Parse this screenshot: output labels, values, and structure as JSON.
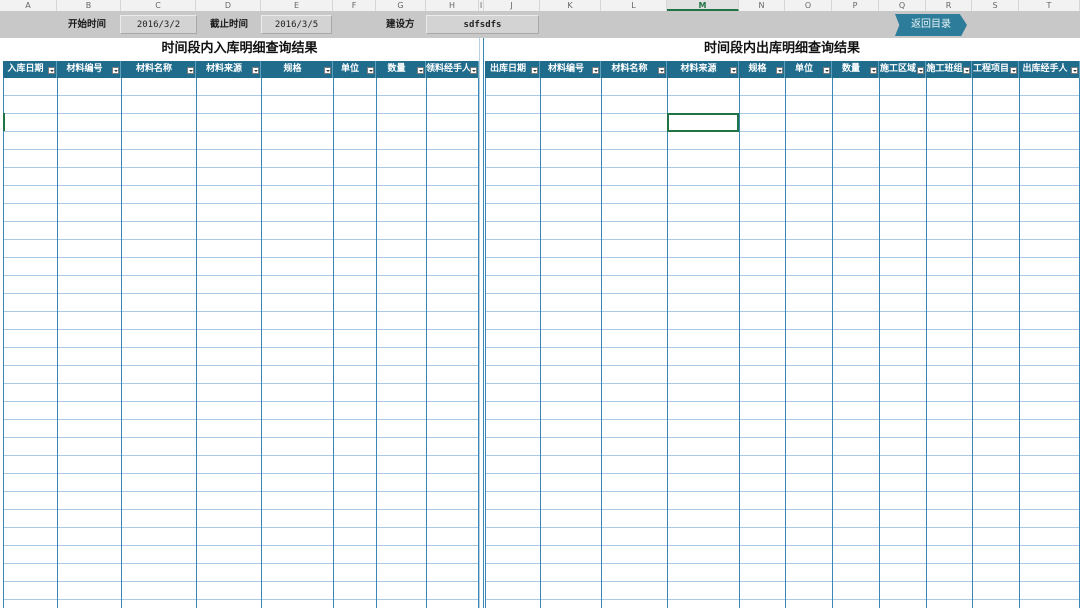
{
  "columns": [
    "A",
    "B",
    "C",
    "D",
    "E",
    "F",
    "G",
    "H",
    "I",
    "J",
    "K",
    "L",
    "M",
    "N",
    "O",
    "P",
    "Q",
    "R",
    "S",
    "T"
  ],
  "active_column": "M",
  "toolbar": {
    "start_label": "开始时间",
    "start_value": "2016/3/2",
    "end_label": "截止时间",
    "end_value": "2016/3/5",
    "builder_label": "建设方",
    "builder_value": "sdfsdfs",
    "back_label": "返回目录"
  },
  "inbound": {
    "title": "时间段内入库明细查询结果",
    "headers": [
      "入库日期",
      "材料编号",
      "材料名称",
      "材料来源",
      "规格",
      "单位",
      "数量",
      "领料经手人"
    ]
  },
  "outbound": {
    "title": "时间段内出库明细查询结果",
    "headers": [
      "出库日期",
      "材料编号",
      "材料名称",
      "材料来源",
      "规格",
      "单位",
      "数量",
      "施工区域",
      "施工班组",
      "工程项目",
      "出库经手人"
    ]
  },
  "colors": {
    "header_blue": "#1f6c8c",
    "toolbar_gray": "#c8c8c8",
    "back_button": "#2d7d9a",
    "selection_green": "#217346"
  }
}
